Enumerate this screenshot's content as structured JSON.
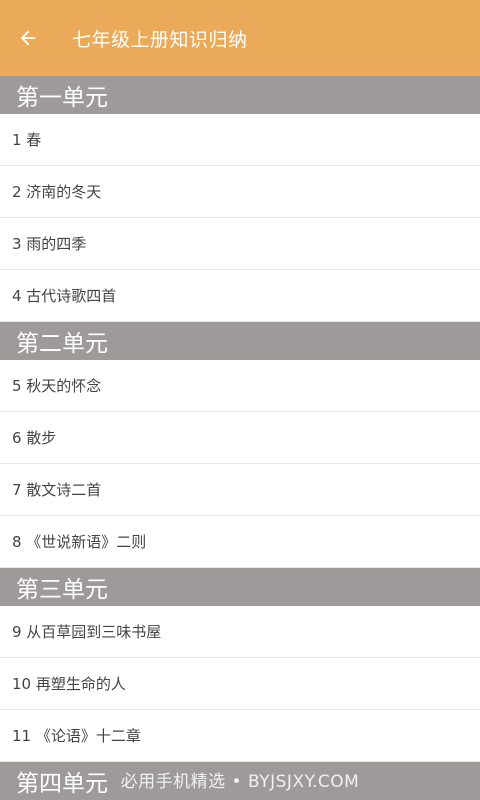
{
  "header": {
    "back_icon": "arrow-left-icon",
    "title": "七年级上册知识归纳"
  },
  "colors": {
    "toolbar": "#eaaa59",
    "section_header": "#9e9a9a"
  },
  "sections": [
    {
      "title": "第一单元",
      "items": [
        "1 春",
        "2 济南的冬天",
        "3 雨的四季",
        "4 古代诗歌四首"
      ]
    },
    {
      "title": "第二单元",
      "items": [
        "5 秋天的怀念",
        "6 散步",
        "7 散文诗二首",
        "8 《世说新语》二则"
      ]
    },
    {
      "title": "第三单元",
      "items": [
        "9 从百草园到三味书屋",
        "10 再塑生命的人",
        "11 《论语》十二章"
      ]
    },
    {
      "title": "第四单元",
      "items": []
    }
  ],
  "watermark": "必用手机精选 • BYJSJXY.COM"
}
